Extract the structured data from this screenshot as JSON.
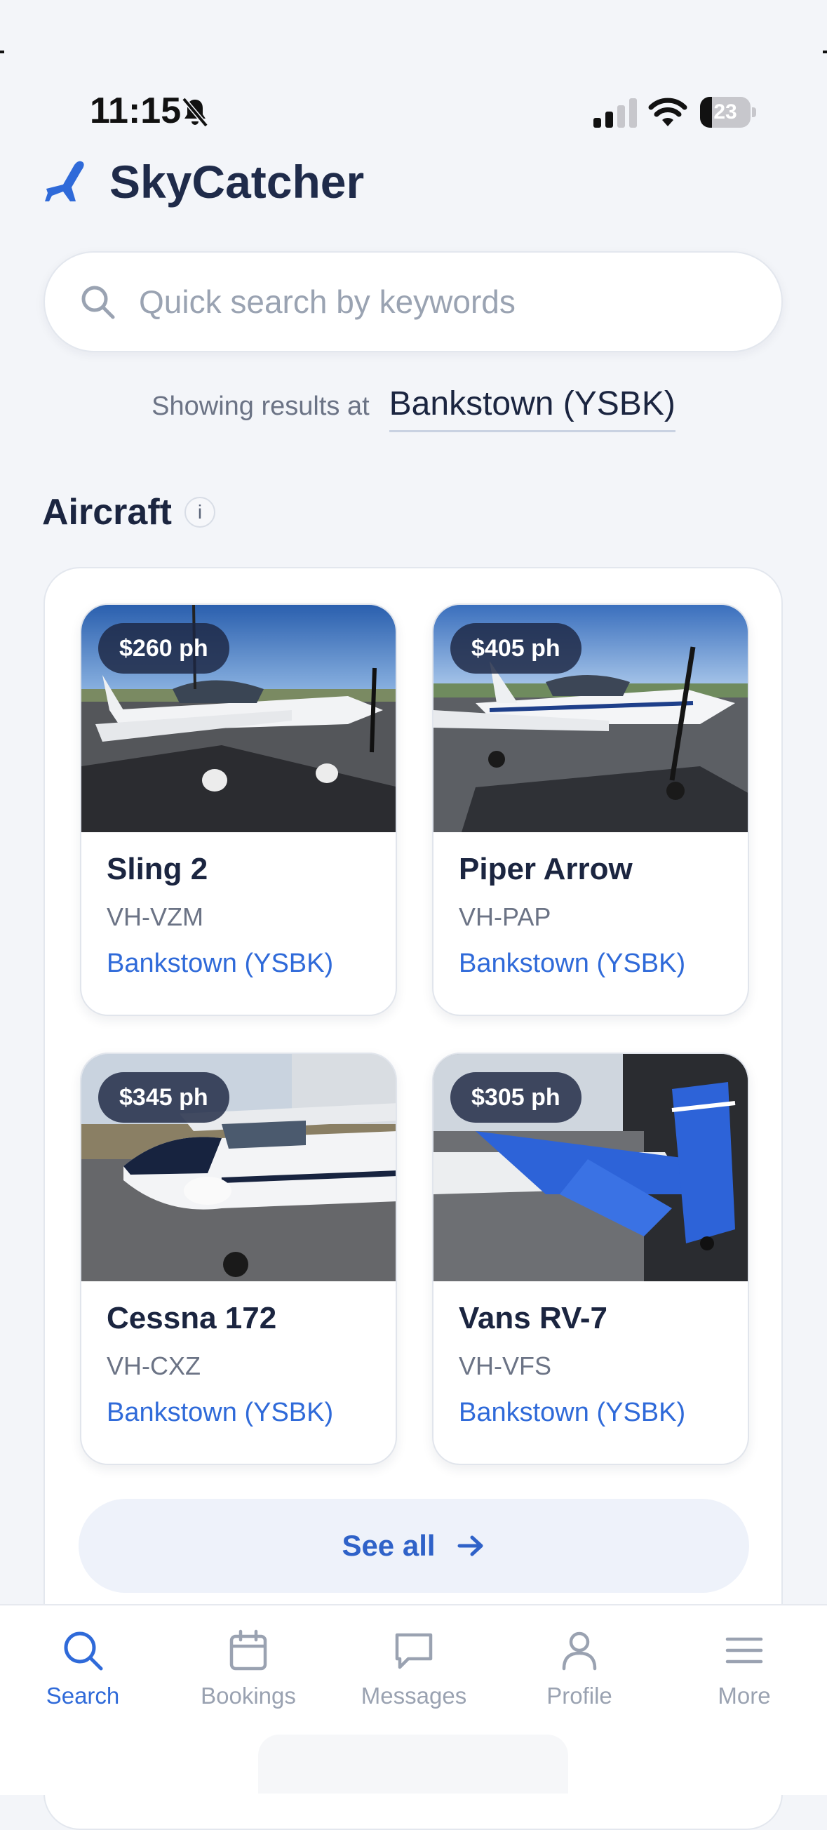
{
  "status_bar": {
    "time": "11:15",
    "battery": "23",
    "battery_level": 0.23
  },
  "brand": {
    "name": "SkyCatcher",
    "icon": "plane-icon"
  },
  "search": {
    "placeholder": "Quick search by keywords",
    "value": ""
  },
  "location": {
    "label": "Showing results at",
    "value": "Bankstown (YSBK)"
  },
  "aircraft_section": {
    "title": "Aircraft",
    "info_label": "i",
    "items": [
      {
        "price": "$260 ph",
        "name": "Sling 2",
        "registration": "VH-VZM",
        "location": "Bankstown (YSBK)"
      },
      {
        "price": "$405 ph",
        "name": "Piper Arrow",
        "registration": "VH-PAP",
        "location": "Bankstown (YSBK)"
      },
      {
        "price": "$345 ph",
        "name": "Cessna 172",
        "registration": "VH-CXZ",
        "location": "Bankstown (YSBK)"
      },
      {
        "price": "$305 ph",
        "name": "Vans RV-7",
        "registration": "VH-VFS",
        "location": "Bankstown (YSBK)"
      }
    ],
    "see_all": "See all"
  },
  "tabbar": {
    "items": [
      {
        "label": "Search",
        "icon": "search-icon",
        "active": true
      },
      {
        "label": "Bookings",
        "icon": "calendar-icon",
        "active": false
      },
      {
        "label": "Messages",
        "icon": "message-icon",
        "active": false
      },
      {
        "label": "Profile",
        "icon": "user-icon",
        "active": false
      },
      {
        "label": "More",
        "icon": "menu-icon",
        "active": false
      }
    ]
  },
  "colors": {
    "accent": "#2f6ad9",
    "text_dark": "#1b2540",
    "muted": "#6b7385",
    "background": "#f3f5f9"
  }
}
